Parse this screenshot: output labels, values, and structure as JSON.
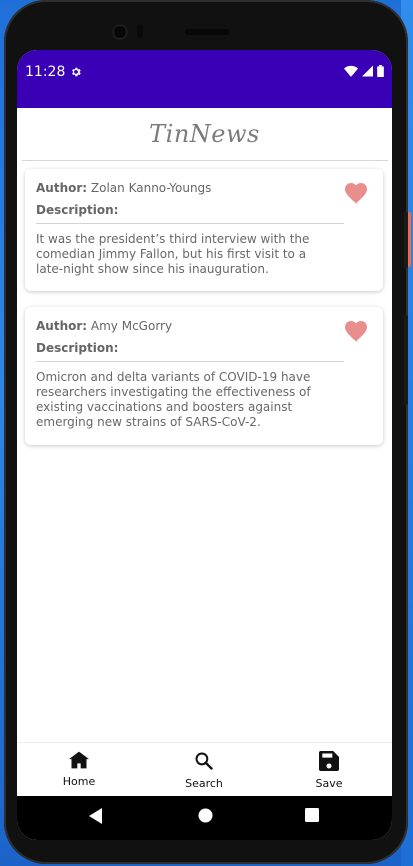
{
  "status_bar": {
    "time": "11:28",
    "icons": [
      "settings-icon",
      "wifi-icon",
      "signal-icon",
      "battery-icon"
    ]
  },
  "app": {
    "title": "TinNews"
  },
  "articles": [
    {
      "author_label": "Author:",
      "author": "Zolan Kanno-Youngs",
      "description_label": "Description:",
      "description": "It was the president’s third interview with the comedian Jimmy Fallon, but his first visit to a late-night show since his inauguration.",
      "favorite_icon": "heart-icon"
    },
    {
      "author_label": "Author:",
      "author": "Amy McGorry",
      "description_label": "Description:",
      "description": "Omicron and delta variants of COVID-19 have researchers investigating the effectiveness of existing vaccinations and boosters against emerging new strains of SARS-CoV-2.",
      "favorite_icon": "heart-icon"
    }
  ],
  "bottom_nav": {
    "items": [
      {
        "label": "Home",
        "icon": "home-icon"
      },
      {
        "label": "Search",
        "icon": "search-icon"
      },
      {
        "label": "Save",
        "icon": "save-icon"
      }
    ]
  },
  "system_nav": {
    "icons": [
      "back-icon",
      "home-circle-icon",
      "recents-icon"
    ]
  },
  "colors": {
    "status_bar": "#3a00b5",
    "heart": "#ea8d8d",
    "desktop_background": "#1f6fd8"
  }
}
